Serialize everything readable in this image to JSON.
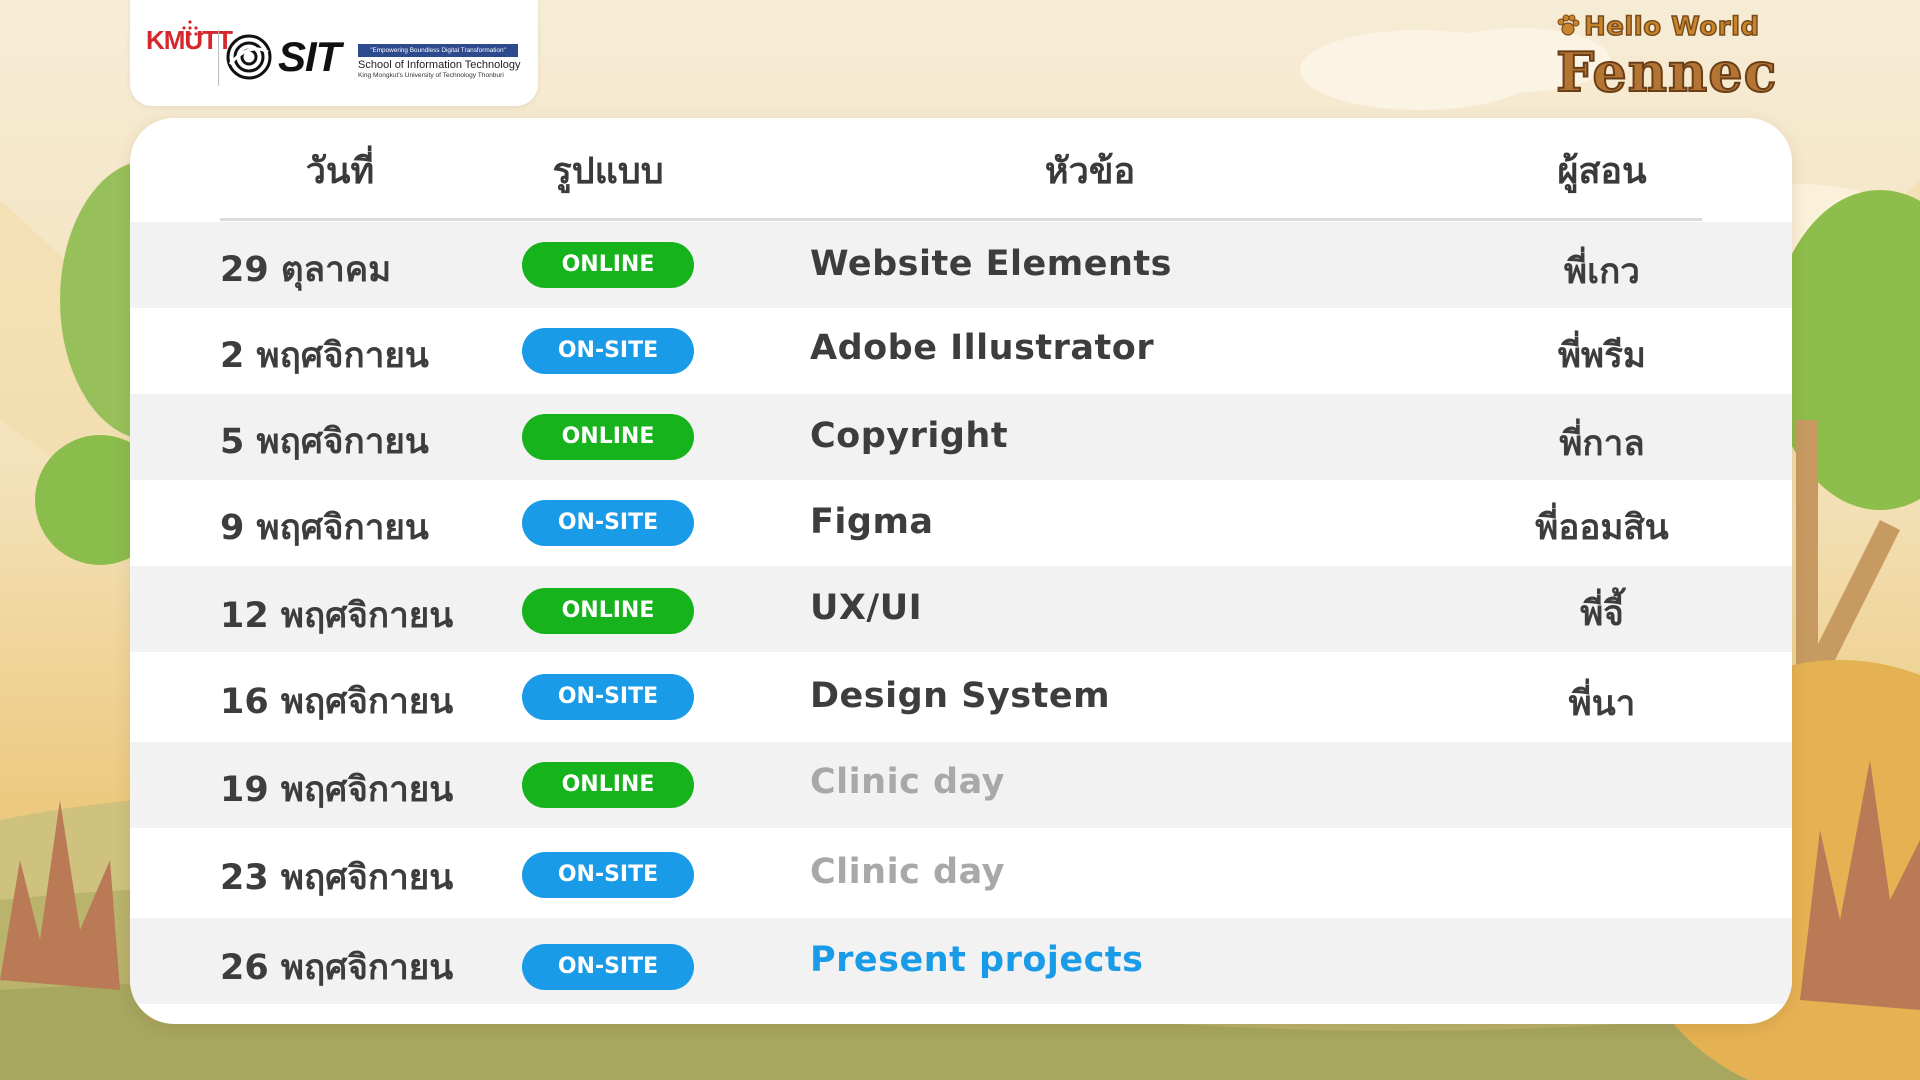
{
  "branding": {
    "kmutt_logo_text": "KMUTT",
    "sit_logo_text": "SIT",
    "sit_tagline": "\"Empowering Boundless Digital Transformation\"",
    "sit_school_name": "School of Information Technology",
    "sit_university": "King Mongkut's University of Technology Thonburi",
    "event_line1": "Hello World",
    "event_line2": "Fennec"
  },
  "table": {
    "headers": {
      "date": "วันที่",
      "format": "รูปแบบ",
      "topic": "หัวข้อ",
      "instructor": "ผู้สอน"
    },
    "rows": [
      {
        "date": "29 ตุลาคม",
        "format": "ONLINE",
        "topic": "Website Elements",
        "instructor": "พี่เกว"
      },
      {
        "date": "2 พฤศจิกายน",
        "format": "ON-SITE",
        "topic": "Adobe Illustrator",
        "instructor": "พี่พรีม"
      },
      {
        "date": "5 พฤศจิกายน",
        "format": "ONLINE",
        "topic": "Copyright",
        "instructor": "พี่กาล"
      },
      {
        "date": "9 พฤศจิกายน",
        "format": "ON-SITE",
        "topic": "Figma",
        "instructor": "พี่ออมสิน"
      },
      {
        "date": "12 พฤศจิกายน",
        "format": "ONLINE",
        "topic": "UX/UI",
        "instructor": "พี่จี้"
      },
      {
        "date": "16 พฤศจิกายน",
        "format": "ON-SITE",
        "topic": "Design System",
        "instructor": "พี่นา"
      },
      {
        "date": "19 พฤศจิกายน",
        "format": "ONLINE",
        "topic": "Clinic day",
        "instructor": ""
      },
      {
        "date": "23 พฤศจิกายน",
        "format": "ON-SITE",
        "topic": "Clinic day",
        "instructor": ""
      },
      {
        "date": "26 พฤศจิกายน",
        "format": "ON-SITE",
        "topic": "Present projects",
        "instructor": ""
      }
    ]
  },
  "colors": {
    "online": "#17b31c",
    "onsite": "#1a9be8",
    "accent_topic": "#1a9be8",
    "muted_topic": "#a8a8a8"
  }
}
